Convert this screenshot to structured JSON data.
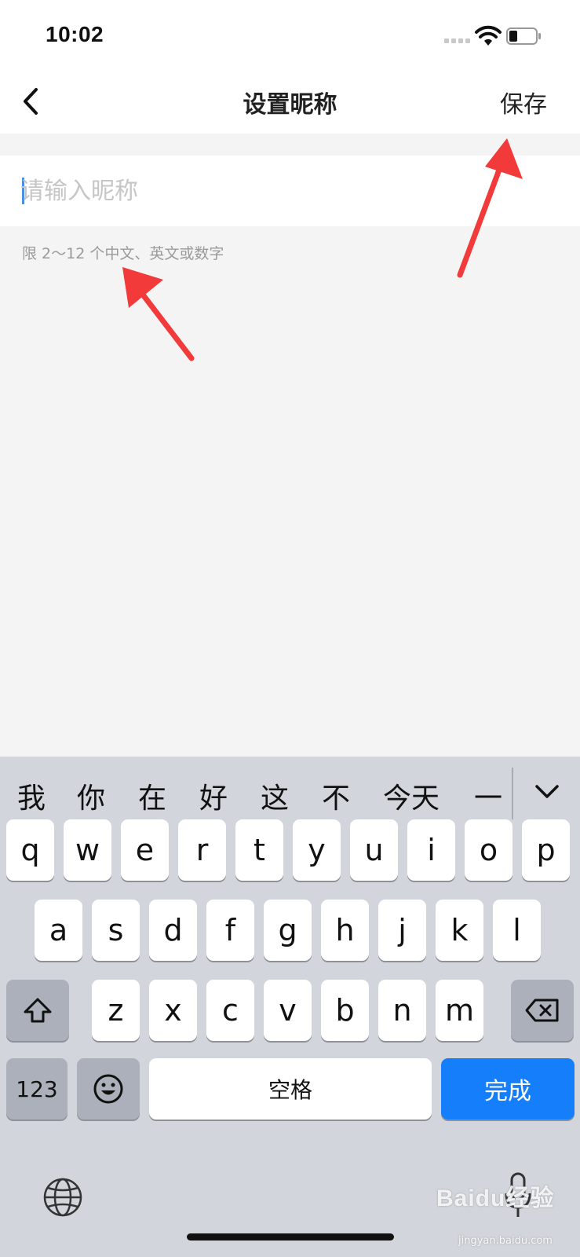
{
  "status_bar": {
    "time": "10:02",
    "icons": [
      "signal-icon",
      "wifi-icon",
      "battery-icon"
    ]
  },
  "nav": {
    "back_icon": "chevron-left-icon",
    "title": "设置昵称",
    "save_label": "保存"
  },
  "form": {
    "nickname_placeholder": "请输入昵称",
    "nickname_value": "",
    "hint": "限 2～12 个中文、英文或数字"
  },
  "keyboard": {
    "candidates": [
      "我",
      "你",
      "在",
      "好",
      "这",
      "不",
      "今天",
      "一"
    ],
    "collapse_icon": "chevron-down-icon",
    "row1": [
      "q",
      "w",
      "e",
      "r",
      "t",
      "y",
      "u",
      "i",
      "o",
      "p"
    ],
    "row2": [
      "a",
      "s",
      "d",
      "f",
      "g",
      "h",
      "j",
      "k",
      "l"
    ],
    "row3": [
      "z",
      "x",
      "c",
      "v",
      "b",
      "n",
      "m"
    ],
    "shift_icon": "shift-icon",
    "delete_icon": "backspace-icon",
    "numbers_label": "123",
    "emoji_icon": "emoji-icon",
    "space_label": "空格",
    "done_label": "完成",
    "globe_icon": "globe-icon",
    "mic_icon": "microphone-icon"
  },
  "watermark": {
    "text": "Baidu经验",
    "sub": "jingyan.baidu.com"
  },
  "colors": {
    "accent": "#147efb",
    "annotation": "#f23a3a",
    "background": "#f4f4f4"
  }
}
